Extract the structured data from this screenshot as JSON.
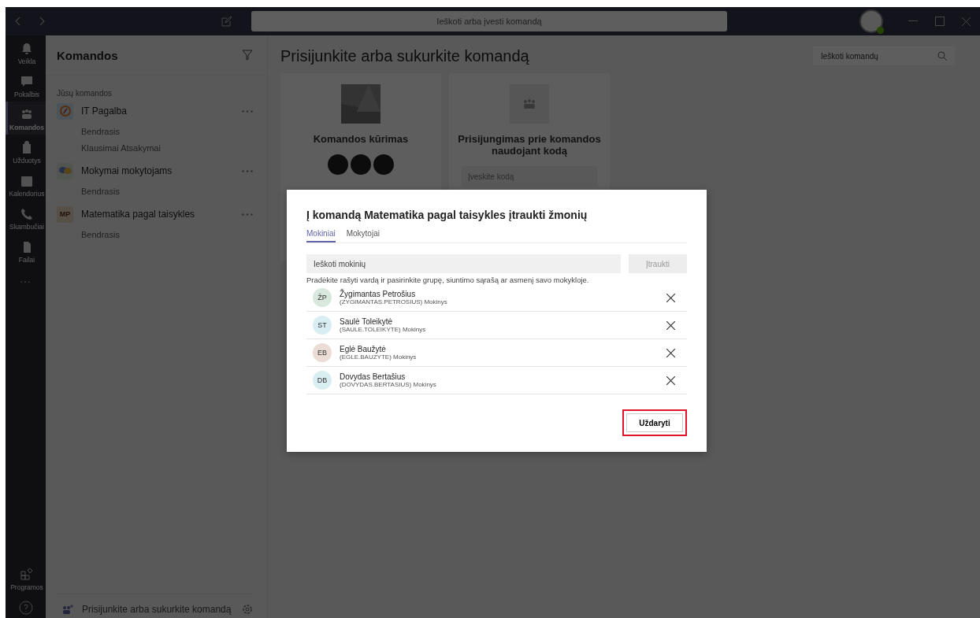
{
  "titlebar": {
    "search_placeholder": "Ieškoti arba įvesti komandą"
  },
  "rail": {
    "items": [
      {
        "label": "Veikla",
        "selected": false
      },
      {
        "label": "Pokalbis",
        "selected": false
      },
      {
        "label": "Komandos",
        "selected": true
      },
      {
        "label": "Užduotys",
        "selected": false
      },
      {
        "label": "Kalendorius",
        "selected": false
      },
      {
        "label": "Skambučiai",
        "selected": false
      },
      {
        "label": "Failai",
        "selected": false
      }
    ],
    "more": "...",
    "apps_label": "Programos"
  },
  "teams_panel": {
    "title": "Komandos",
    "section": "Jūsų komandos",
    "teams": [
      {
        "name": "IT Pagalba",
        "kind": "compass",
        "channels": [
          "Bendrasis",
          "Klausimai Atsakymai"
        ]
      },
      {
        "name": "Mokymai mokytojams",
        "kind": "bubbles",
        "channels": [
          "Bendrasis"
        ]
      },
      {
        "name": "Matematika pagal taisykles",
        "kind": "initials",
        "initials": "MP",
        "channels": [
          "Bendrasis"
        ]
      }
    ],
    "footer": "Prisijunkite arba sukurkite komandą"
  },
  "main": {
    "title": "Prisijunkite arba sukurkite komandą",
    "search_placeholder": "Ieškoti komandų",
    "cards": [
      {
        "title": "Komandos kūrimas",
        "kind": "create"
      },
      {
        "title": "Prisijungimas prie komandos naudojant kodą",
        "kind": "join",
        "placeholder": "Įveskite kodą"
      }
    ]
  },
  "dialog": {
    "title": "Į komandą Matematika pagal taisykles įtraukti žmonių",
    "tabs": [
      {
        "label": "Mokiniai",
        "selected": true
      },
      {
        "label": "Mokytojai",
        "selected": false
      }
    ],
    "search_placeholder": "Ieškoti mokinių",
    "add_button": {
      "label": "Įtraukti",
      "disabled": true
    },
    "hint": "Pradėkite rašyti vardą ir pasirinkite grupę, siuntimo sąrašą ar asmenį savo mokykloje.",
    "people": [
      {
        "initials": "ŽP",
        "name": "Žygimantas Petrošius",
        "detail": "(ZYGIMANTAS.PETROSIUS) Mokinys",
        "color": "#d9e8dc"
      },
      {
        "initials": "ST",
        "name": "Saulė Toleikytė",
        "detail": "(SAULE.TOLEIKYTE) Mokinys",
        "color": "#d9eef2"
      },
      {
        "initials": "EB",
        "name": "Eglė Baužytė",
        "detail": "(EGLE.BAUZYTE) Mokinys",
        "color": "#ecdcd6"
      },
      {
        "initials": "DB",
        "name": "Dovydas Bertašius",
        "detail": "(DOVYDAS.BERTASIUS) Mokinys",
        "color": "#d9eef0"
      }
    ],
    "close_button": {
      "label": "Uždaryti",
      "highlighted": true
    }
  }
}
